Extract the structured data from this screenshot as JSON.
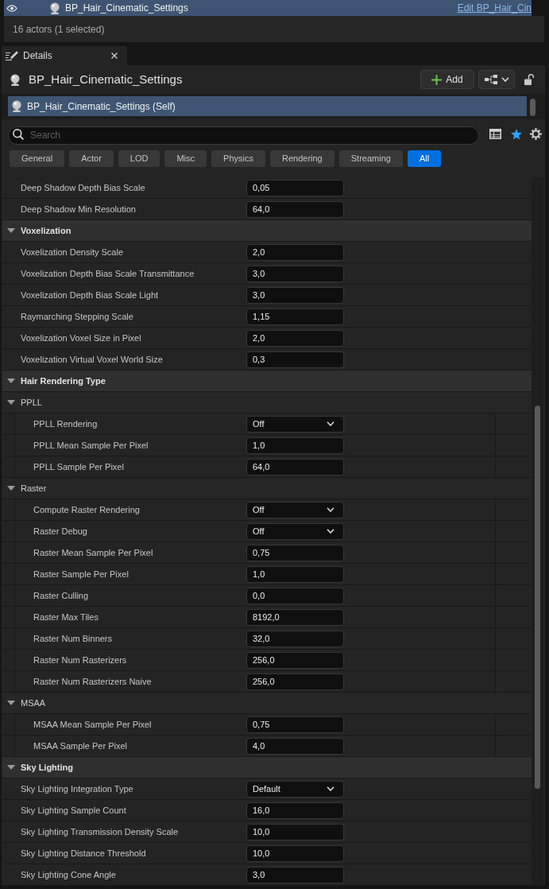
{
  "outliner": {
    "row": {
      "name": "BP_Hair_Cinematic_Settings",
      "link": "Edit BP_Hair_Cin",
      "selected": true
    },
    "status": "16 actors (1 selected)"
  },
  "details": {
    "tab": {
      "label": "Details"
    },
    "title": "BP_Hair_Cinematic_Settings",
    "add_button": "Add",
    "components": [
      {
        "name": "BP_Hair_Cinematic_Settings (Self)",
        "selected": true
      }
    ],
    "search": {
      "placeholder": "Search"
    },
    "filters": [
      {
        "label": "General",
        "selected": false
      },
      {
        "label": "Actor",
        "selected": false
      },
      {
        "label": "LOD",
        "selected": false
      },
      {
        "label": "Misc",
        "selected": false
      },
      {
        "label": "Physics",
        "selected": false
      },
      {
        "label": "Rendering",
        "selected": false
      },
      {
        "label": "Streaming",
        "selected": false
      },
      {
        "label": "All",
        "selected": true
      }
    ],
    "properties": [
      {
        "kind": "number",
        "label": "Deep Shadow Depth Bias Scale",
        "value": "0,05"
      },
      {
        "kind": "number",
        "label": "Deep Shadow Min Resolution",
        "value": "64,0"
      },
      {
        "kind": "category",
        "label": "Voxelization",
        "expanded": true,
        "children": [
          {
            "kind": "number",
            "label": "Voxelization Density Scale",
            "value": "2,0"
          },
          {
            "kind": "number",
            "label": "Voxelization Depth Bias Scale Transmittance",
            "value": "3,0"
          },
          {
            "kind": "number",
            "label": "Voxelization Depth Bias Scale Light",
            "value": "3,0"
          },
          {
            "kind": "number",
            "label": "Raymarching Stepping Scale",
            "value": "1,15"
          },
          {
            "kind": "number",
            "label": "Voxelization Voxel Size in Pixel",
            "value": "2,0"
          },
          {
            "kind": "number",
            "label": "Voxelization Virtual Voxel World Size",
            "value": "0,3"
          }
        ]
      },
      {
        "kind": "category",
        "label": "Hair Rendering Type",
        "expanded": true,
        "children": [
          {
            "kind": "group",
            "label": "PPLL",
            "expanded": true,
            "children": [
              {
                "kind": "dropdown",
                "label": "PPLL Rendering",
                "value": "Off"
              },
              {
                "kind": "number",
                "label": "PPLL Mean Sample Per Pixel",
                "value": "1,0"
              },
              {
                "kind": "number",
                "label": "PPLL Sample Per Pixel",
                "value": "64,0"
              }
            ]
          },
          {
            "kind": "group",
            "label": "Raster",
            "expanded": true,
            "children": [
              {
                "kind": "dropdown",
                "label": "Compute Raster Rendering",
                "value": "Off"
              },
              {
                "kind": "dropdown",
                "label": "Raster Debug",
                "value": "Off"
              },
              {
                "kind": "number",
                "label": "Raster Mean Sample Per Pixel",
                "value": "0,75"
              },
              {
                "kind": "number",
                "label": "Raster Sample Per Pixel",
                "value": "1,0"
              },
              {
                "kind": "number",
                "label": "Raster Culling",
                "value": "0,0"
              },
              {
                "kind": "number",
                "label": "Raster Max Tiles",
                "value": "8192,0"
              },
              {
                "kind": "number",
                "label": "Raster Num Binners",
                "value": "32,0"
              },
              {
                "kind": "number",
                "label": "Raster Num Rasterizers",
                "value": "256,0"
              },
              {
                "kind": "number",
                "label": "Raster Num Rasterizers Naive",
                "value": "256,0"
              }
            ]
          },
          {
            "kind": "group",
            "label": "MSAA",
            "expanded": true,
            "children": [
              {
                "kind": "number",
                "label": "MSAA Mean Sample Per Pixel",
                "value": "0,75"
              },
              {
                "kind": "number",
                "label": "MSAA Sample Per Pixel",
                "value": "4,0"
              }
            ]
          }
        ]
      },
      {
        "kind": "category",
        "label": "Sky Lighting",
        "expanded": true,
        "children": [
          {
            "kind": "dropdown",
            "label": "Sky Lighting Integration Type",
            "value": "Default"
          },
          {
            "kind": "number",
            "label": "Sky Lighting Sample Count",
            "value": "16,0"
          },
          {
            "kind": "number",
            "label": "Sky Lighting Transmission Density Scale",
            "value": "10,0"
          },
          {
            "kind": "number",
            "label": "Sky Lighting Distance Threshold",
            "value": "10,0"
          },
          {
            "kind": "number",
            "label": "Sky Lighting Cone Angle",
            "value": "3,0"
          }
        ]
      }
    ]
  }
}
